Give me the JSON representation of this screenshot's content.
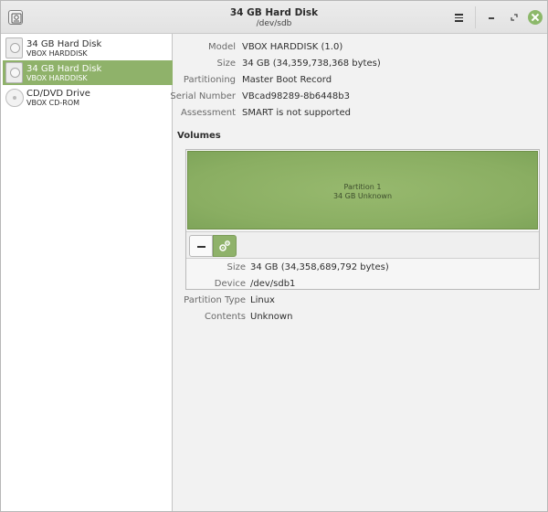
{
  "titlebar": {
    "title": "34 GB Hard Disk",
    "subtitle": "/dev/sdb"
  },
  "drives": [
    {
      "name": "34 GB Hard Disk",
      "model": "VBOX HARDDISK",
      "selected": false,
      "icon": "hard-disk-icon"
    },
    {
      "name": "34 GB Hard Disk",
      "model": "VBOX HARDDISK",
      "selected": true,
      "icon": "hard-disk-icon"
    },
    {
      "name": "CD/DVD Drive",
      "model": "VBOX CD-ROM",
      "selected": false,
      "icon": "optical-disc-icon"
    }
  ],
  "disk_props": [
    {
      "label": "Model",
      "value": "VBOX HARDDISK (1.0)"
    },
    {
      "label": "Size",
      "value": "34 GB (34,359,738,368 bytes)"
    },
    {
      "label": "Partitioning",
      "value": "Master Boot Record"
    },
    {
      "label": "Serial Number",
      "value": "VBcad98289-8b6448b3"
    },
    {
      "label": "Assessment",
      "value": "SMART is not supported"
    }
  ],
  "volumes": {
    "title": "Volumes",
    "partition": {
      "name": "Partition 1",
      "desc": "34 GB Unknown"
    }
  },
  "volume_props": [
    {
      "label": "Size",
      "value": "34 GB (34,358,689,792 bytes)"
    },
    {
      "label": "Device",
      "value": "/dev/sdb1"
    },
    {
      "label": "Partition Type",
      "value": "Linux"
    },
    {
      "label": "Contents",
      "value": "Unknown"
    }
  ],
  "colors": {
    "accent": "#8fb26a",
    "close_button": "#8cb86a"
  }
}
